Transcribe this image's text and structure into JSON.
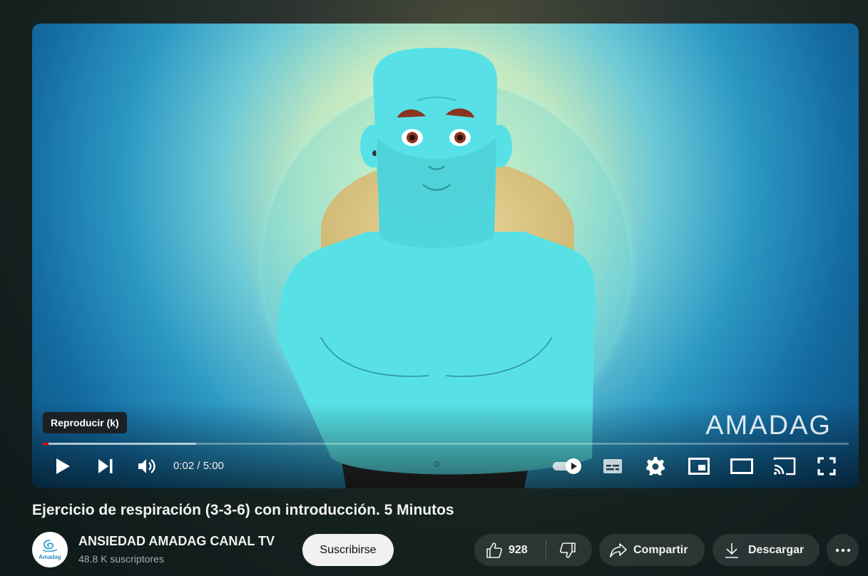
{
  "player": {
    "watermark": "AMADAG",
    "tooltip": "Reproducir (k)",
    "current_time": "0:02",
    "duration": "5:00",
    "time_display": "0:02 / 5:00",
    "progress_played": 0.007,
    "progress_buffered": 0.19,
    "autoplay_on": true
  },
  "video": {
    "title": "Ejercicio de respiración (3-3-6) con introducción. 5 Minutos"
  },
  "channel": {
    "name": "ANSIEDAD AMADAG CANAL TV",
    "subscribers": "48.8 K suscriptores",
    "avatar_text": "Amadag",
    "subscribe_label": "Suscribirse"
  },
  "actions": {
    "likes": "928",
    "share_label": "Compartir",
    "download_label": "Descargar"
  },
  "colors": {
    "progress_red": "#ff0000",
    "character_cyan": "#57e1e6"
  }
}
